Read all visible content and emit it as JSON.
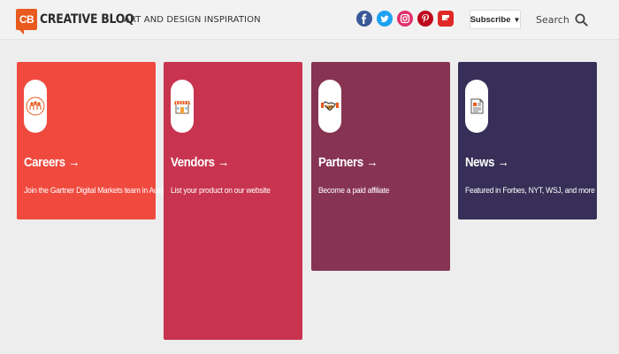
{
  "header": {
    "logo_badge": "CB",
    "logo_text": "CREATIVE BLOQ",
    "tagline": "ART AND DESIGN INSPIRATION",
    "social": [
      {
        "name": "facebook-icon",
        "color": "#3b5998"
      },
      {
        "name": "twitter-icon",
        "color": "#1da1f2"
      },
      {
        "name": "instagram-icon",
        "color": "#e1306c"
      },
      {
        "name": "pinterest-icon",
        "color": "#bd081c"
      },
      {
        "name": "flipboard-icon",
        "color": "#e12828"
      }
    ],
    "subscribe_label": "Subscribe",
    "subscribe_caret": "▼",
    "search_label": "Search"
  },
  "cards": [
    {
      "title": "Careers",
      "arrow": "→",
      "description": "Join the Gartner Digital Markets team in Austin",
      "color": "#f04a3f",
      "icon": "people-icon"
    },
    {
      "title": "Vendors",
      "arrow": "→",
      "description": "List your product on our website",
      "color": "#c8344f",
      "icon": "storefront-icon"
    },
    {
      "title": "Partners",
      "arrow": "→",
      "description": "Become a paid affiliate",
      "color": "#873453",
      "icon": "handshake-icon"
    },
    {
      "title": "News",
      "arrow": "→",
      "description": "Featured in Forbes, NYT, WSJ, and more",
      "color": "#372f57",
      "icon": "newspaper-icon"
    }
  ]
}
